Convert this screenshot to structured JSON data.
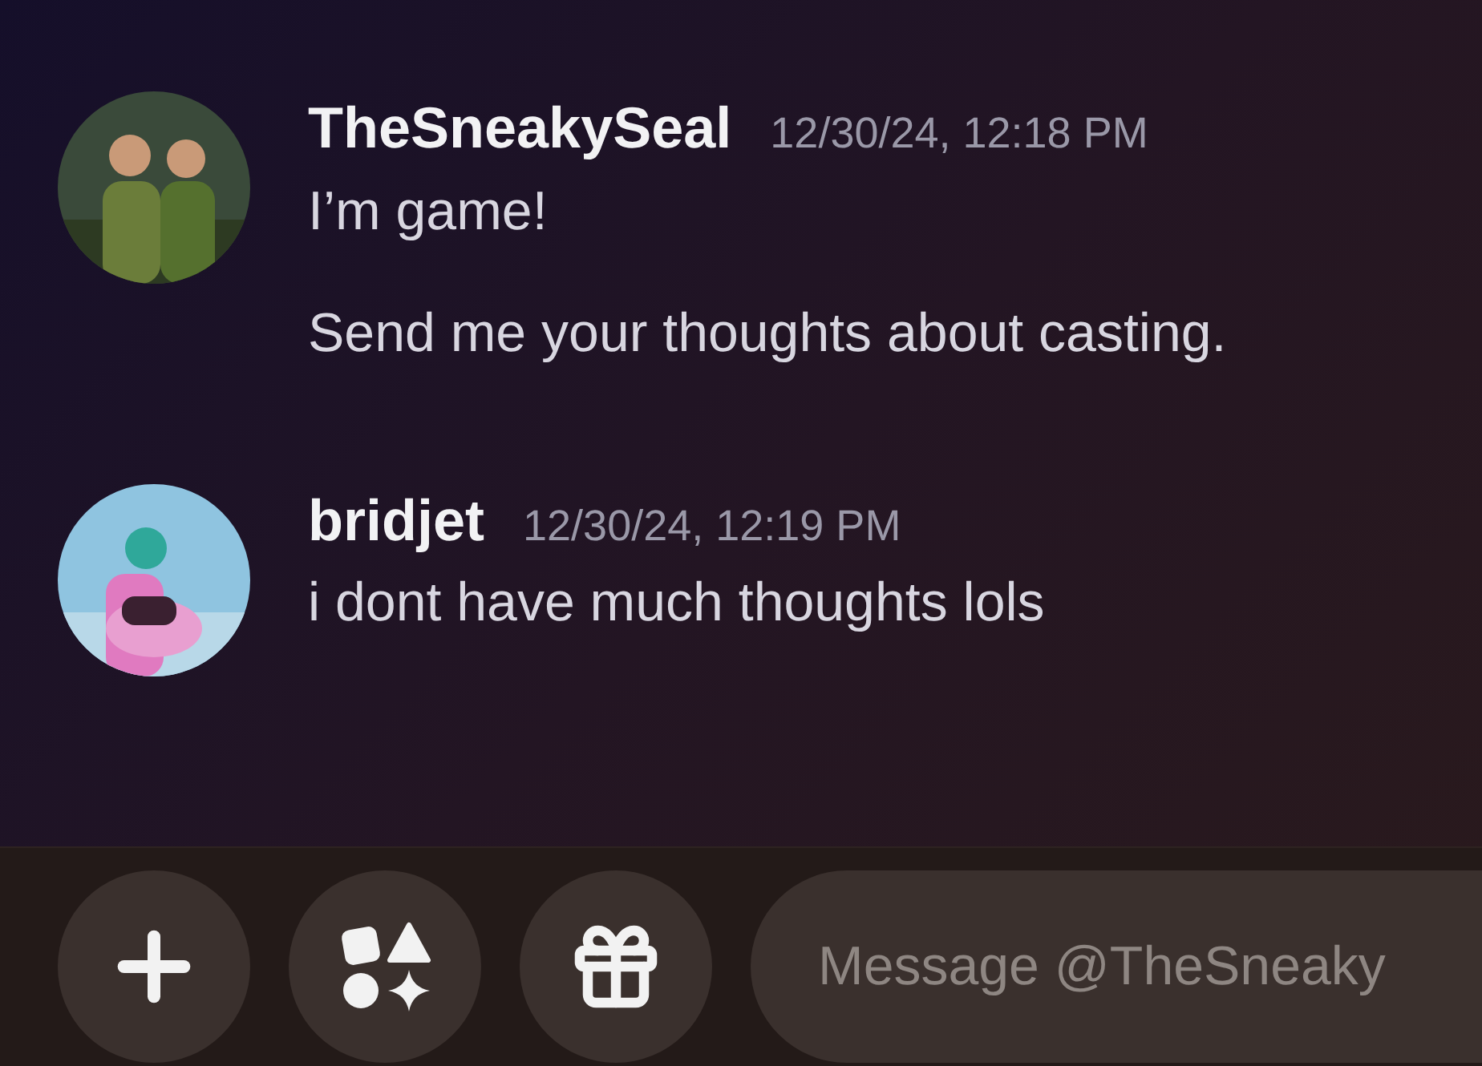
{
  "messages": [
    {
      "author": "TheSneakySeal",
      "timestamp": "12/30/24, 12:18 PM",
      "avatar": {
        "kind": "picture"
      },
      "lines": [
        "I’m game!",
        "Send me your thoughts about casting."
      ]
    },
    {
      "author": "bridjet",
      "timestamp": "12/30/24, 12:19 PM",
      "avatar": {
        "kind": "picture"
      },
      "lines": [
        "i dont have much thoughts lols"
      ]
    }
  ],
  "composer": {
    "placeholder": "Message @TheSneaky"
  }
}
